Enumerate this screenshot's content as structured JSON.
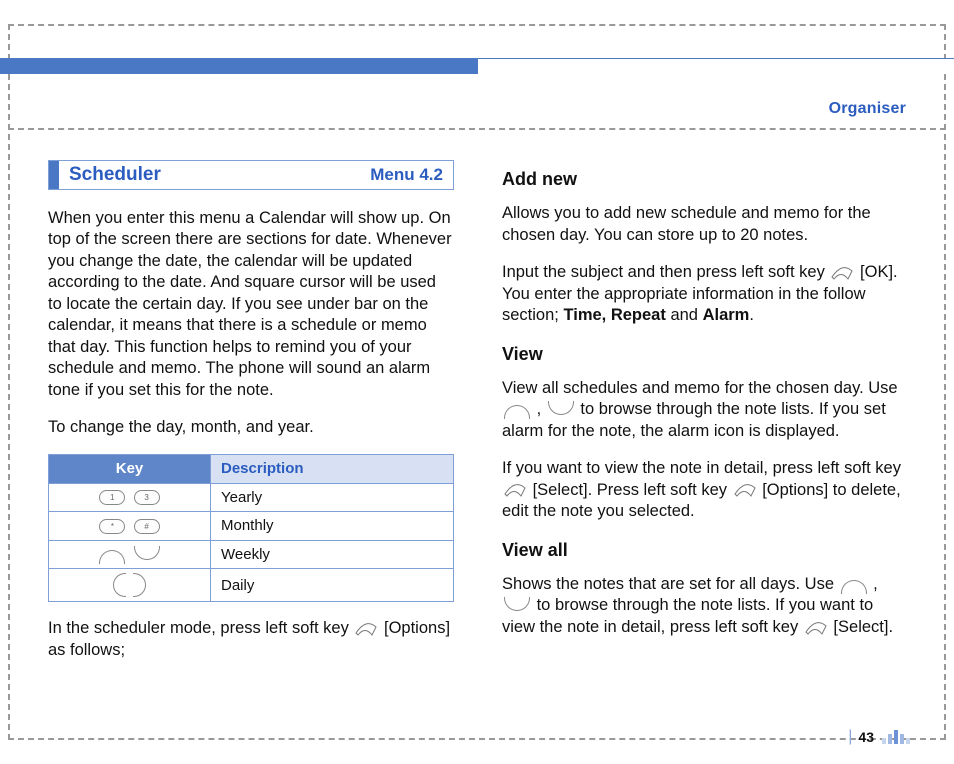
{
  "header": {
    "section_label": "Organiser"
  },
  "page_number": "43",
  "left": {
    "title": "Scheduler",
    "menu": "Menu 4.2",
    "intro": "When you enter this menu a Calendar will show up. On top of the screen there are sections for date. Whenever you change the date, the calendar will be updated according to the date. And square cursor will be used to locate the certain day. If you see under bar on the calendar, it means that there is a schedule or memo that day. This function helps to remind you of your schedule and memo. The phone will sound an alarm tone if you set this for the note.",
    "change_line": "To change the day, month, and year.",
    "table": {
      "head_key": "Key",
      "head_desc": "Description",
      "rows": [
        {
          "desc": "Yearly"
        },
        {
          "desc": "Monthly"
        },
        {
          "desc": "Weekly"
        },
        {
          "desc": "Daily"
        }
      ]
    },
    "footer_a": "In the scheduler mode, press left soft key ",
    "footer_b": " [Options] as follows;"
  },
  "right": {
    "add_new": {
      "title": "Add new",
      "p1": "Allows you to add new schedule and memo for the chosen day. You can store up to 20 notes.",
      "p2a": "Input the subject and then press left soft key ",
      "p2b": " [OK]. You enter the appropriate information in the follow section; ",
      "bold": "Time, Repeat",
      "p2c": " and ",
      "bold2": "Alarm",
      "p2d": "."
    },
    "view": {
      "title": "View",
      "p1a": "View all schedules and memo for the chosen day. Use ",
      "p1b": " , ",
      "p1c": " to browse through the note lists. If you set alarm for the note, the alarm icon is displayed.",
      "p2a": "If you want to view the note in detail, press left soft key ",
      "p2b": " [Select]. Press left soft key ",
      "p2c": " [Options] to delete, edit the note you selected."
    },
    "view_all": {
      "title": "View all",
      "p1a": "Shows the notes that are set for all days. Use ",
      "p1b": " , ",
      "p1c": " to browse through the note lists. If you want to view the note in detail, press left soft key ",
      "p1d": " [Select]."
    }
  }
}
